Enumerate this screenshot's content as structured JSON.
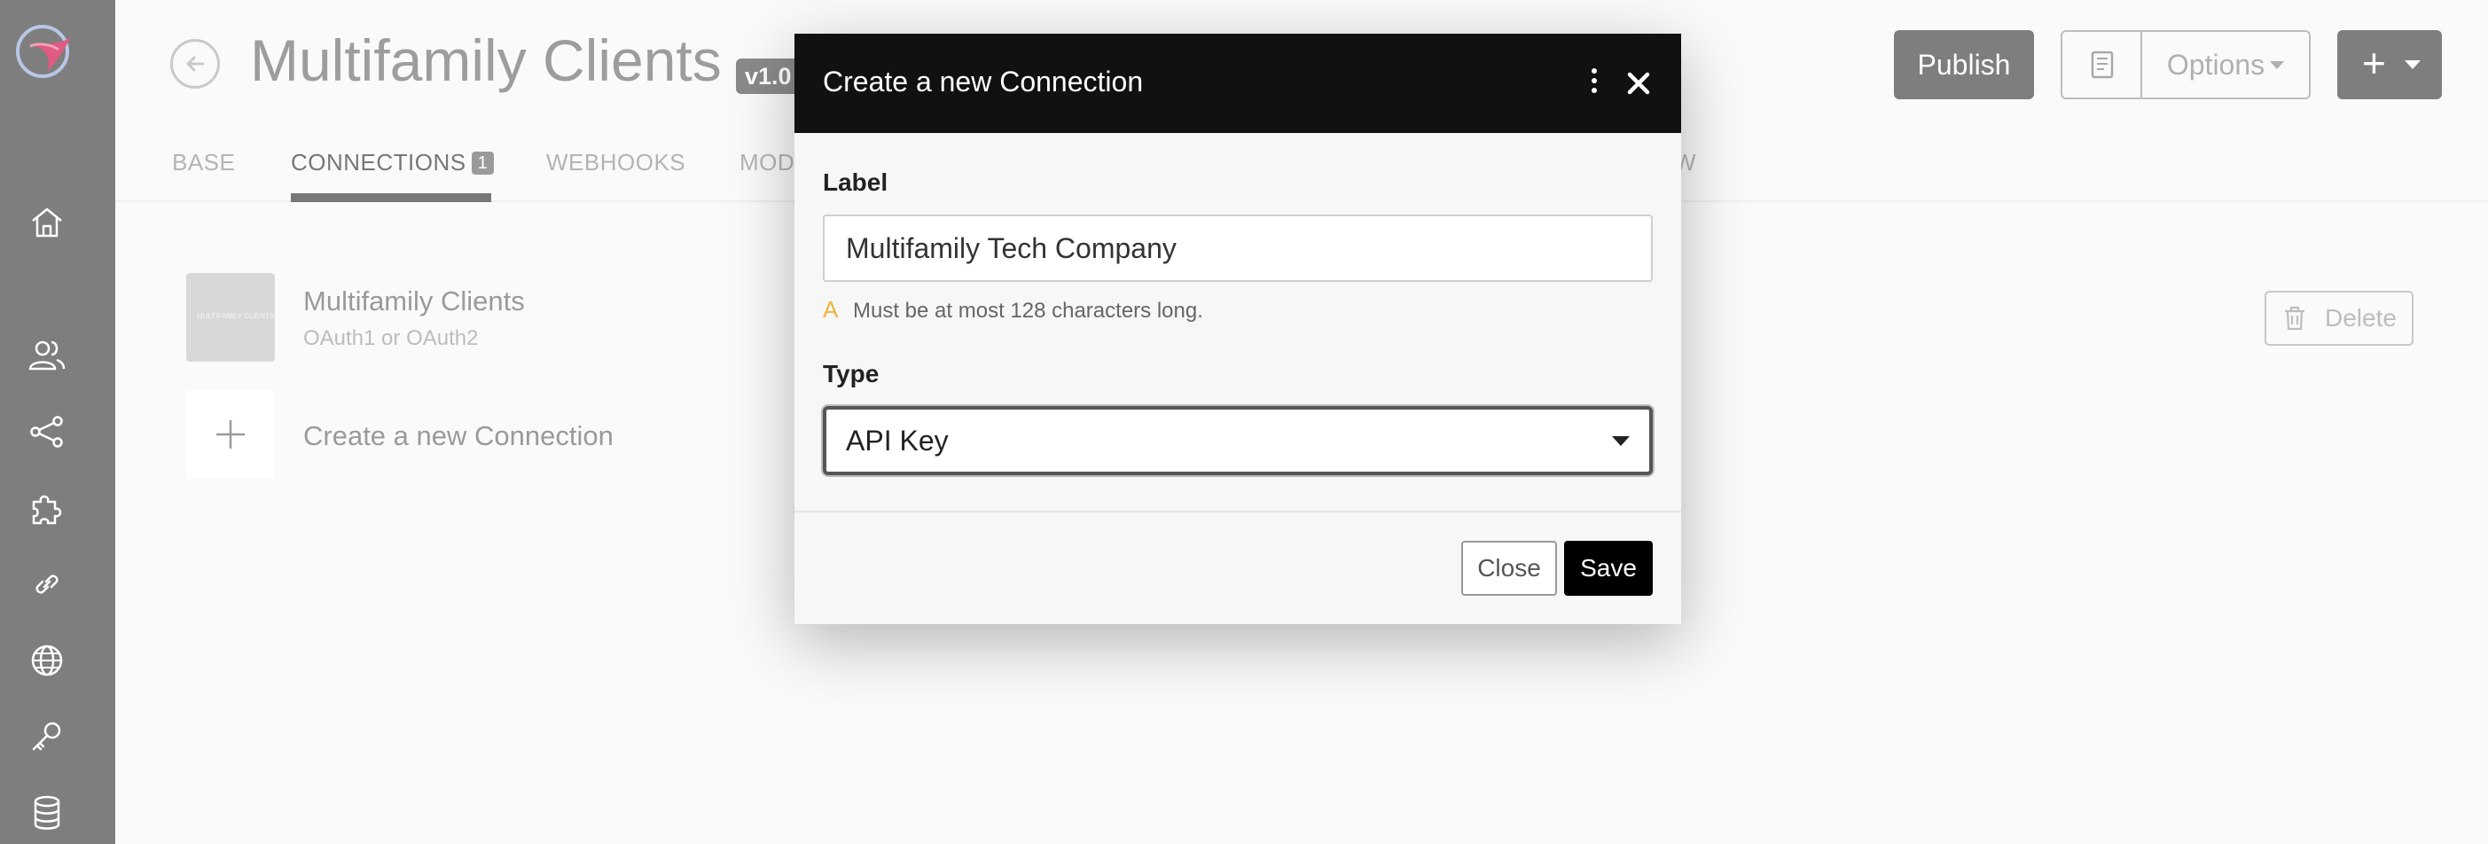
{
  "app": {
    "title": "Multifamily Clients",
    "version": "v1.0"
  },
  "tabs": [
    {
      "label": "BASE"
    },
    {
      "label": "CONNECTIONS",
      "badge": "1"
    },
    {
      "label": "WEBHOOKS"
    },
    {
      "label": "MOD"
    },
    {
      "label": "W"
    }
  ],
  "toolbar": {
    "publish_label": "Publish",
    "options_label": "Options",
    "add_label": "+"
  },
  "connections": {
    "items": [
      {
        "name": "Multifamily Clients",
        "subtitle": "OAuth1 or OAuth2",
        "thumb_text": "MULTIFAMILY CLIENTS"
      }
    ],
    "create_label": "Create a new Connection",
    "delete_label": "Delete"
  },
  "modal": {
    "title": "Create a new Connection",
    "label_field": {
      "label": "Label",
      "value": "Multifamily Tech Company",
      "hint_icon": "A",
      "hint": "Must be at most 128 characters long."
    },
    "type_field": {
      "label": "Type",
      "value": "API Key"
    },
    "close_label": "Close",
    "save_label": "Save"
  },
  "colors": {
    "sidebar": "#7e7e7e",
    "modal_header": "#111111",
    "warning": "#f0b43c",
    "save_button": "#000000"
  }
}
